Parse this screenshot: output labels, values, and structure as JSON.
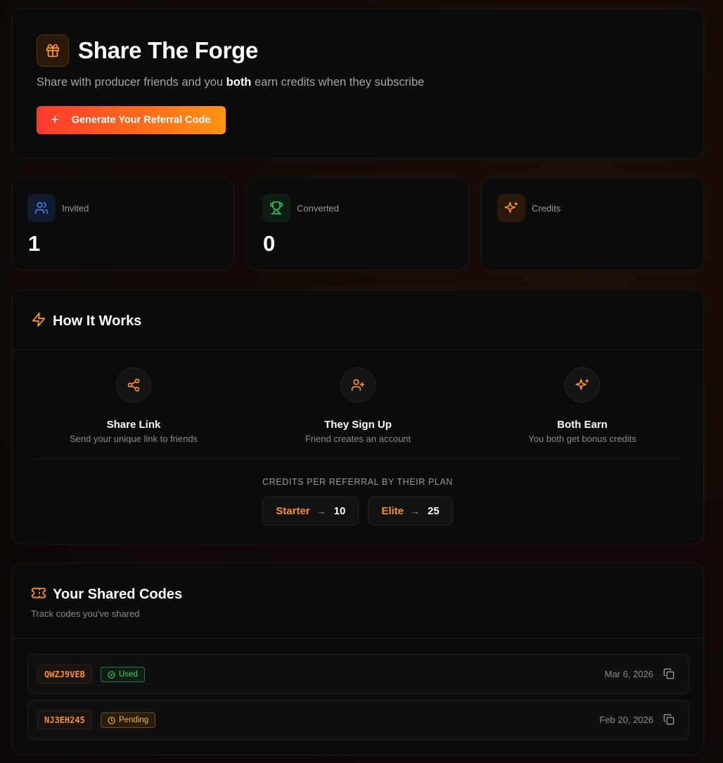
{
  "header": {
    "title": "Share The Forge",
    "subtitle_pre": "Share with producer friends and you ",
    "subtitle_bold": "both",
    "subtitle_post": " earn credits when they subscribe",
    "generate_button": "Generate Your Referral Code",
    "icon": "gift-icon"
  },
  "stats": [
    {
      "label": "Invited",
      "value": "1",
      "icon": "users-icon",
      "color": "#4a7fe0"
    },
    {
      "label": "Converted",
      "value": "0",
      "icon": "trophy-icon",
      "color": "#2fc45c"
    },
    {
      "label": "Credits",
      "value": "",
      "icon": "sparkles-icon",
      "color": "#f7931e"
    }
  ],
  "how_it_works": {
    "title": "How It Works",
    "steps": [
      {
        "title": "Share Link",
        "desc": "Send your unique link to friends",
        "icon": "share-icon"
      },
      {
        "title": "They Sign Up",
        "desc": "Friend creates an account",
        "icon": "user-plus-icon"
      },
      {
        "title": "Both Earn",
        "desc": "You both get bonus credits",
        "icon": "sparkles-icon"
      }
    ],
    "credits_caption": "CREDITS PER REFERRAL BY THEIR PLAN",
    "plans": [
      {
        "name": "Starter",
        "value": "10"
      },
      {
        "name": "Elite",
        "value": "25"
      }
    ]
  },
  "shared_codes": {
    "title": "Your Shared Codes",
    "subtitle": "Track codes you've shared",
    "rows": [
      {
        "code": "QWZJ9VEB",
        "status": "Used",
        "date": "Mar 6, 2026"
      },
      {
        "code": "NJ3EH245",
        "status": "Pending",
        "date": "Feb 20, 2026"
      }
    ]
  },
  "colors": {
    "accent": "#f7931e",
    "gradient_start": "#ff3a2e",
    "gradient_end": "#ff9512",
    "used": "#3ecf6b",
    "pending": "#f2b33d"
  }
}
